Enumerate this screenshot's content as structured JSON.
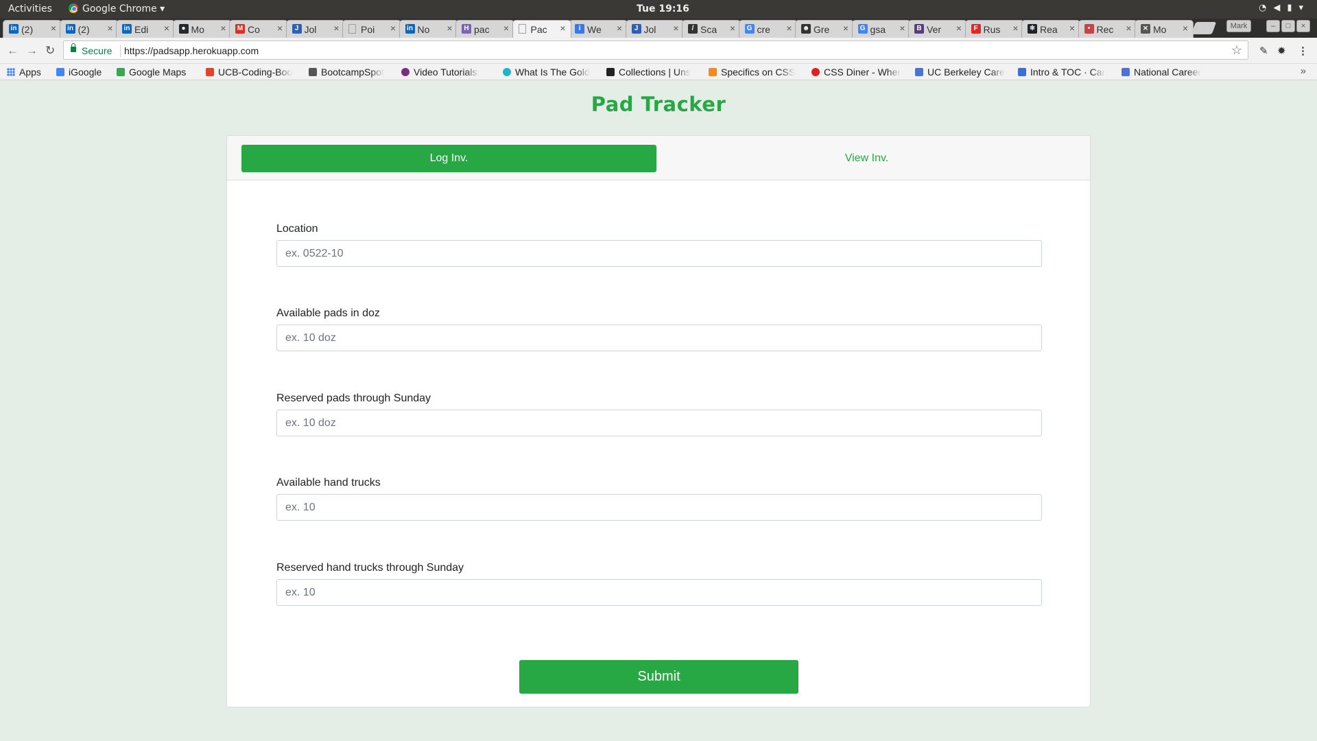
{
  "os_bar": {
    "activities": "Activities",
    "app_name": "Google Chrome ▾",
    "clock": "Tue 19:16",
    "status_icons": [
      "wifi-icon",
      "volume-icon",
      "battery-icon",
      "power-menu-icon"
    ]
  },
  "browser": {
    "tabs": [
      {
        "title": "(2)",
        "favicon": "linkedin-icon",
        "color": "#0a66c2",
        "glyph": "in"
      },
      {
        "title": "(2)",
        "favicon": "linkedin-icon",
        "color": "#0a66c2",
        "glyph": "in"
      },
      {
        "title": "Edi",
        "favicon": "linkedin-icon",
        "color": "#0a66c2",
        "glyph": "in"
      },
      {
        "title": "Mo",
        "favicon": "github-icon",
        "color": "#24292e",
        "glyph": "●"
      },
      {
        "title": "Co",
        "favicon": "gmail-icon",
        "color": "#d93025",
        "glyph": "M"
      },
      {
        "title": "Jol",
        "favicon": "jobs-icon",
        "color": "#2d5eb8",
        "glyph": "J"
      },
      {
        "title": "Poi",
        "favicon": "page-icon",
        "color": "#9e9e9e",
        "glyph": ""
      },
      {
        "title": "No",
        "favicon": "linkedin-icon",
        "color": "#0a66c2",
        "glyph": "in"
      },
      {
        "title": "pac",
        "favicon": "heroku-icon",
        "color": "#7b63b6",
        "glyph": "H"
      },
      {
        "title": "Pac",
        "favicon": "page-icon",
        "color": "#9e9e9e",
        "glyph": ""
      },
      {
        "title": "We",
        "favicon": "info-icon",
        "color": "#3b78e7",
        "glyph": "i"
      },
      {
        "title": "Jol",
        "favicon": "jobs-icon",
        "color": "#2d5eb8",
        "glyph": "J"
      },
      {
        "title": "Sca",
        "favicon": "sketch-icon",
        "color": "#333333",
        "glyph": "/"
      },
      {
        "title": "cre",
        "favicon": "google-icon",
        "color": "#4285f4",
        "glyph": "G"
      },
      {
        "title": "Gre",
        "favicon": "greasemonkey-icon",
        "color": "#333333",
        "glyph": "☻"
      },
      {
        "title": "gsa",
        "favicon": "google-icon",
        "color": "#4285f4",
        "glyph": "G"
      },
      {
        "title": "Ver",
        "favicon": "bootstrap-icon",
        "color": "#563d7c",
        "glyph": "B"
      },
      {
        "title": "Rus",
        "favicon": "flipboard-icon",
        "color": "#e12828",
        "glyph": "F"
      },
      {
        "title": "Rea",
        "favicon": "react-icon",
        "color": "#20232a",
        "glyph": "⚛"
      },
      {
        "title": "Rec",
        "favicon": "react-router-icon",
        "color": "#ca4245",
        "glyph": "•"
      },
      {
        "title": "Mo",
        "favicon": "inspect-icon",
        "color": "#555555",
        "glyph": "⨯"
      }
    ],
    "active_tab_index": 9,
    "profile_name": "Mark",
    "address": {
      "secure_label": "Secure",
      "url": "https://padsapp.herokuapp.com"
    },
    "bookmarks": [
      {
        "label": "Apps",
        "icon": "apps-grid-icon",
        "color": "#4285f4"
      },
      {
        "label": "iGoogle",
        "icon": "google-icon",
        "color": "#4285f4"
      },
      {
        "label": "Google Maps",
        "icon": "maps-icon",
        "color": "#34a853"
      },
      {
        "label": "UCB-Coding-Boo",
        "icon": "gitlab-icon",
        "color": "#e24329"
      },
      {
        "label": "BootcampSpot",
        "icon": "shield-icon",
        "color": "#555555"
      },
      {
        "label": "Video Tutorials:",
        "icon": "video-icon",
        "color": "#7b2d85"
      },
      {
        "label": "What Is The Gold",
        "icon": "c-icon",
        "color": "#1fb5c8"
      },
      {
        "label": "Collections | Uns",
        "icon": "camera-icon",
        "color": "#222222"
      },
      {
        "label": "Specifics on CSS",
        "icon": "asterisk-icon",
        "color": "#f08a24"
      },
      {
        "label": "CSS Diner - Wher",
        "icon": "dot-icon",
        "color": "#e02020"
      },
      {
        "label": "UC Berkeley Care",
        "icon": "doc-icon",
        "color": "#4a73d9"
      },
      {
        "label": "Intro & TOC · Car",
        "icon": "stack-icon",
        "color": "#3a6fd8"
      },
      {
        "label": "National Career",
        "icon": "doc-icon",
        "color": "#4a73d9"
      }
    ]
  },
  "app": {
    "title": "Pad Tracker",
    "brand_color": "#28a745",
    "tabs": {
      "log": "Log Inv.",
      "view": "View Inv."
    },
    "fields": [
      {
        "label": "Location",
        "placeholder": "ex. 0522-10",
        "value": ""
      },
      {
        "label": "Available pads in doz",
        "placeholder": "ex. 10 doz",
        "value": ""
      },
      {
        "label": "Reserved pads through Sunday",
        "placeholder": "ex. 10 doz",
        "value": ""
      },
      {
        "label": "Available hand trucks",
        "placeholder": "ex. 10",
        "value": ""
      },
      {
        "label": "Reserved hand trucks through Sunday",
        "placeholder": "ex. 10",
        "value": ""
      }
    ],
    "submit_label": "Submit"
  }
}
